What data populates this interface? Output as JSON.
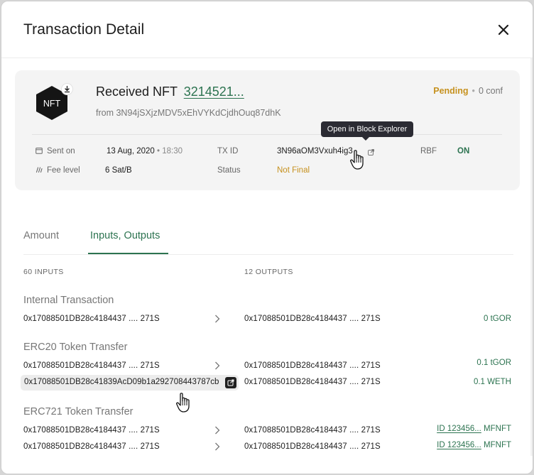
{
  "modal": {
    "title": "Transaction Detail"
  },
  "tx": {
    "title_prefix": "Received NFT",
    "nft_id": "3214521...",
    "from_text": "from 3N94jSXjzMDV5xEhVYKdCjdhOuq87dhK",
    "state": "Pending",
    "confirmations": "0 conf",
    "sent_on_label": "Sent on",
    "sent_on_date": "13 Aug, 2020",
    "sent_on_time": "18:30",
    "fee_label": "Fee level",
    "fee_value": "6 Sat/B",
    "txid_label": "TX ID",
    "txid_value": "3N96aOM3Vxuh4ig3",
    "status_label": "Status",
    "status_value": "Not Final",
    "rbf_label": "RBF",
    "rbf_value": "ON",
    "tooltip": "Open in Block Explorer"
  },
  "tabs": [
    {
      "label": "Amount",
      "active": false
    },
    {
      "label": "Inputs, Outputs",
      "active": true
    }
  ],
  "columns": {
    "inputs": "60 INPUTS",
    "outputs": "12 OUTPUTS"
  },
  "sections": [
    {
      "title": "Internal Transaction",
      "rows": [
        {
          "input": "0x17088501DB28c4184437 .... 271S",
          "output": "0x17088501DB28c4184437 .... 271S",
          "amount": "0 tGOR"
        }
      ]
    },
    {
      "title": "ERC20 Token Transfer",
      "rows": [
        {
          "input": "0x17088501DB28c4184437 .... 271S",
          "output": "0x17088501DB28c4184437 .... 271S",
          "amount": "0.1 tGOR"
        },
        {
          "input_full": "0x17088501DB28c41839AcD09b1a292708443787cb",
          "output": "0x17088501DB28c4184437 .... 271S",
          "amount": "0.1 WETH"
        }
      ]
    },
    {
      "title": "ERC721 Token Transfer",
      "rows": [
        {
          "input": "0x17088501DB28c4184437 .... 271S",
          "output": "0x17088501DB28c4184437 .... 271S",
          "amount_id": "ID 123456...",
          "amount_unit": "MFNFT"
        },
        {
          "input": "0x17088501DB28c4184437 .... 271S",
          "output": "0x17088501DB28c4184437 .... 271S",
          "amount_id": "ID 123456...",
          "amount_unit": "MFNFT"
        }
      ]
    }
  ],
  "colors": {
    "accent_green": "#2c7350",
    "pending_orange": "#c6911e",
    "tooltip_bg": "#2b2b33"
  },
  "icons": [
    "close-icon",
    "nft-hexagon-icon",
    "download-icon",
    "calendar-icon",
    "fee-icon",
    "external-link-icon",
    "chevron-right-icon",
    "hand-pointer-icon"
  ]
}
